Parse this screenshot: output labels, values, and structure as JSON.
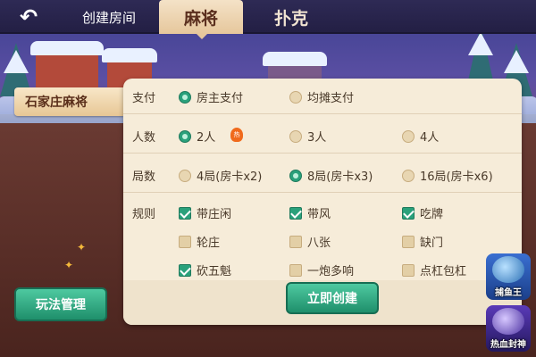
{
  "header": {
    "back_icon": "back-arrow-icon",
    "title": "创建房间",
    "tabs": [
      {
        "label": "麻将",
        "active": true
      },
      {
        "label": "扑克",
        "active": false
      }
    ]
  },
  "sidebar": {
    "category": "石家庄麻将",
    "manage_label": "玩法管理"
  },
  "form": {
    "pay": {
      "label": "支付",
      "options": [
        {
          "label": "房主支付",
          "selected": true
        },
        {
          "label": "均摊支付",
          "selected": false
        }
      ]
    },
    "players": {
      "label": "人数",
      "options": [
        {
          "label": "2人",
          "selected": true,
          "badge": "热"
        },
        {
          "label": "3人",
          "selected": false
        },
        {
          "label": "4人",
          "selected": false
        }
      ]
    },
    "rounds": {
      "label": "局数",
      "options": [
        {
          "label": "4局(房卡x2)",
          "selected": false
        },
        {
          "label": "8局(房卡x3)",
          "selected": true
        },
        {
          "label": "16局(房卡x6)",
          "selected": false
        }
      ]
    },
    "rules": {
      "label": "规则",
      "options": [
        {
          "label": "带庄闲",
          "checked": true
        },
        {
          "label": "带风",
          "checked": true
        },
        {
          "label": "吃牌",
          "checked": true
        },
        {
          "label": "轮庄",
          "checked": false
        },
        {
          "label": "八张",
          "checked": false
        },
        {
          "label": "缺门",
          "checked": false
        },
        {
          "label": "砍五魁",
          "checked": true
        },
        {
          "label": "一炮多响",
          "checked": false
        },
        {
          "label": "点杠包杠",
          "checked": false
        }
      ]
    },
    "create_label": "立即创建"
  },
  "promos": [
    {
      "label": "捕鱼王",
      "icon": "fish-king-icon"
    },
    {
      "label": "热血封神",
      "icon": "fengshen-icon"
    }
  ],
  "colors": {
    "accent_green": "#2aa17b",
    "panel_bg": "#f6ecd9",
    "header_bg": "#2e2a55"
  }
}
